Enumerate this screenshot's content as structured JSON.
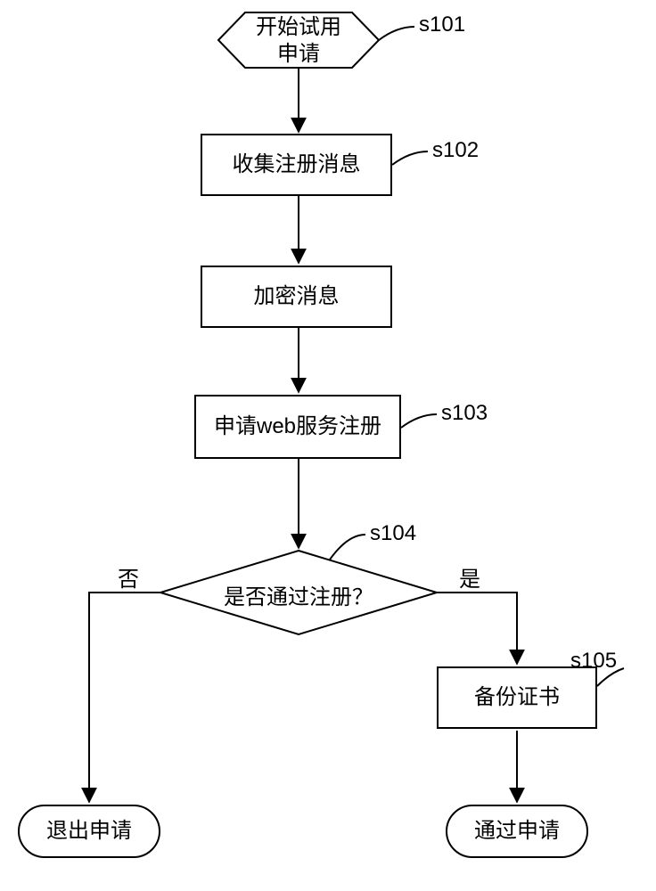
{
  "nodes": {
    "start": {
      "text": "开始试用\n申请",
      "tag": "s101"
    },
    "collect": {
      "text": "收集注册消息",
      "tag": "s102"
    },
    "encrypt": {
      "text": "加密消息",
      "tag": ""
    },
    "apply": {
      "text": "申请web服务注册",
      "tag": "s103"
    },
    "decision": {
      "text": "是否通过注册？",
      "tag": "s104",
      "no": "否",
      "yes": "是"
    },
    "backup": {
      "text": "备份证书",
      "tag": "s105"
    },
    "exit": {
      "text": "退出申请"
    },
    "pass": {
      "text": "通过申请"
    }
  }
}
